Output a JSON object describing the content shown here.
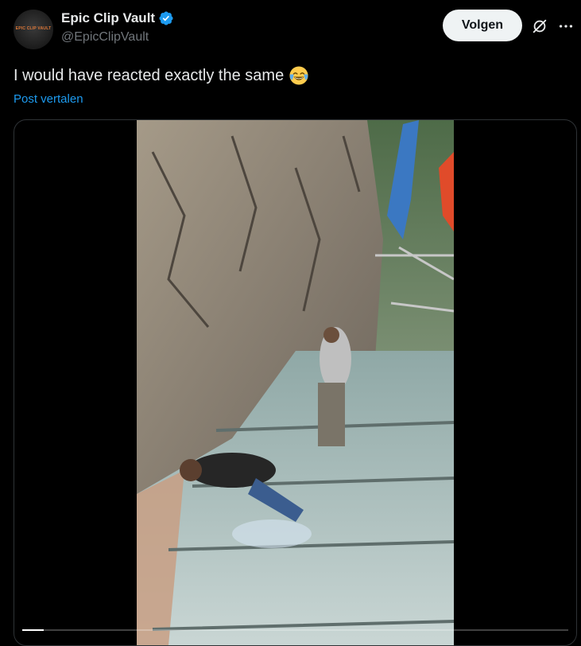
{
  "author": {
    "display_name": "Epic Clip Vault",
    "handle": "@EpicClipVault",
    "avatar_text": "EPIC CLIP VAULT",
    "verified_icon": "verified-badge-icon",
    "verified_color": "#1d9bf0"
  },
  "actions": {
    "follow_label": "Volgen",
    "grok_icon": "grok-icon",
    "more_icon": "more-icon"
  },
  "post": {
    "text": "I would have reacted exactly the same",
    "emoji": "face-with-tears-of-joy",
    "translate_label": "Post vertalen"
  },
  "media": {
    "type": "video",
    "progress": 0.04
  },
  "colors": {
    "background": "#000000",
    "text": "#e7e9ea",
    "secondary": "#71767b",
    "link": "#1d9bf0",
    "button_bg": "#eff3f4"
  }
}
